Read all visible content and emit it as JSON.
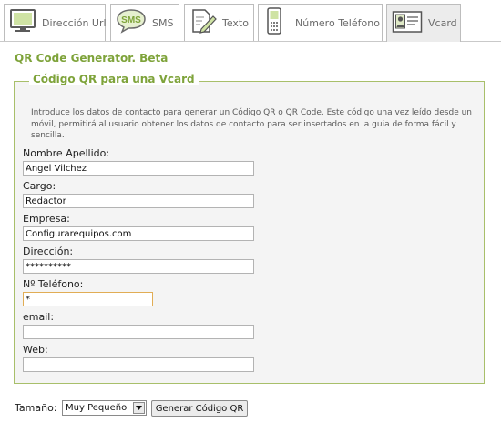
{
  "tabs": [
    {
      "label": "Dirección Url",
      "icon": "monitor-icon"
    },
    {
      "label": "SMS",
      "icon": "sms-bubble-icon",
      "icon_text": "SMS"
    },
    {
      "label": "Texto",
      "icon": "pencil-document-icon"
    },
    {
      "label": "Número Teléfono",
      "icon": "mobile-phone-icon"
    },
    {
      "label": "Vcard",
      "icon": "contact-card-icon"
    }
  ],
  "active_tab": "Vcard",
  "page_title": "QR Code Generator. Beta",
  "panel": {
    "legend": "Código QR para una Vcard",
    "intro": "Introduce los datos de contacto para generar un Código QR o QR Code. Este código una vez leído desde un móvil, permitirá al usuario obtener los datos de contacto para ser insertados en la guia de forma fácil y sencilla."
  },
  "form": {
    "name": {
      "label": "Nombre Apellido:",
      "value": "Angel Vilchez"
    },
    "position": {
      "label": "Cargo:",
      "value": "Redactor"
    },
    "company": {
      "label": "Empresa:",
      "value": "Configurarequipos.com"
    },
    "address": {
      "label": "Dirección:",
      "value": "**********"
    },
    "phone": {
      "label": "Nº Teléfono:",
      "value": "*"
    },
    "email": {
      "label": "email:",
      "value": ""
    },
    "web": {
      "label": "Web:",
      "value": ""
    }
  },
  "size": {
    "label": "Tamaño:",
    "selected": "Muy Pequeño"
  },
  "generate_button": "Generar Código QR",
  "colors": {
    "accent": "#7ea33a",
    "panel_border": "#a8bf6a",
    "focus_border": "#e1ad55"
  }
}
